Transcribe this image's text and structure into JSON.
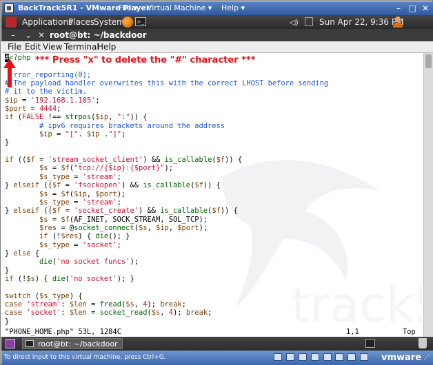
{
  "vmware": {
    "title": "BackTrack5R1 - VMware Player",
    "menu": [
      "File ▾",
      "Virtual Machine ▾",
      "Help ▾"
    ],
    "status_hint": "To direct input to this virtual machine, press Ctrl+G.",
    "brand": "vmware"
  },
  "gnome_panel": {
    "applications": "Applications",
    "places": "Places",
    "system": "System",
    "clock": "Sun Apr 22,  9:36 PM"
  },
  "terminal": {
    "title": "root@bt: ~/backdoor",
    "menu": [
      "File",
      "Edit",
      "View",
      "Terminal",
      "Help"
    ]
  },
  "annotation": "*** Press \"x\" to delete the \"#\" character ***",
  "vim": {
    "cursor_char": "#",
    "status": "\"PHONE_HOME.php\" 53L, 1284C",
    "position": "1,1",
    "scroll": "Top"
  },
  "taskbar": {
    "task_label": "root@bt: ~/backdoor"
  },
  "colors": {
    "comment": "#1f57c8",
    "string": "#c8102e",
    "annotation": "#e2141a"
  }
}
